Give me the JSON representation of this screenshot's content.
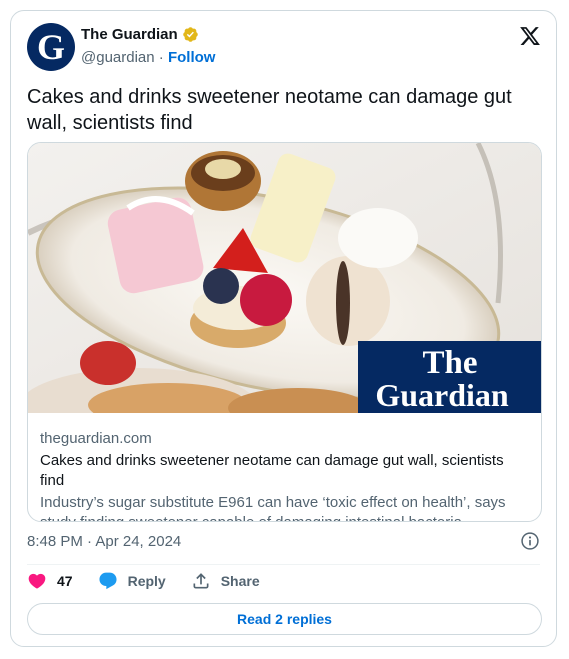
{
  "author": {
    "name": "The Guardian",
    "handle": "@guardian",
    "separator": "·",
    "follow_label": "Follow",
    "avatar_letter": "G",
    "avatar_color": "#052962",
    "verified_color": "#e2b719"
  },
  "tweet": {
    "text": "Cakes and drinks sweetener neotame can damage gut wall, scientists find",
    "timestamp": "8:48 PM · Apr 24, 2024"
  },
  "link_card": {
    "image_description_icon": "dessert-photo",
    "logo_line1": "The",
    "logo_line2": "Guardian",
    "logo_bg": "#052962",
    "domain": "theguardian.com",
    "title": "Cakes and drinks sweetener neotame can damage gut wall, scientists find",
    "description": "Industry’s sugar substitute E961 can have ‘toxic effect on health’, says study finding sweetener capable of damaging intestinal bacteria"
  },
  "actions": {
    "likes": "47",
    "reply_label": "Reply",
    "share_label": "Share",
    "read_replies_label": "Read 2 replies",
    "like_color": "#f91880",
    "reply_color": "#1d9bf0"
  },
  "icons": {
    "close": "x-logo-icon",
    "info": "info-icon"
  }
}
